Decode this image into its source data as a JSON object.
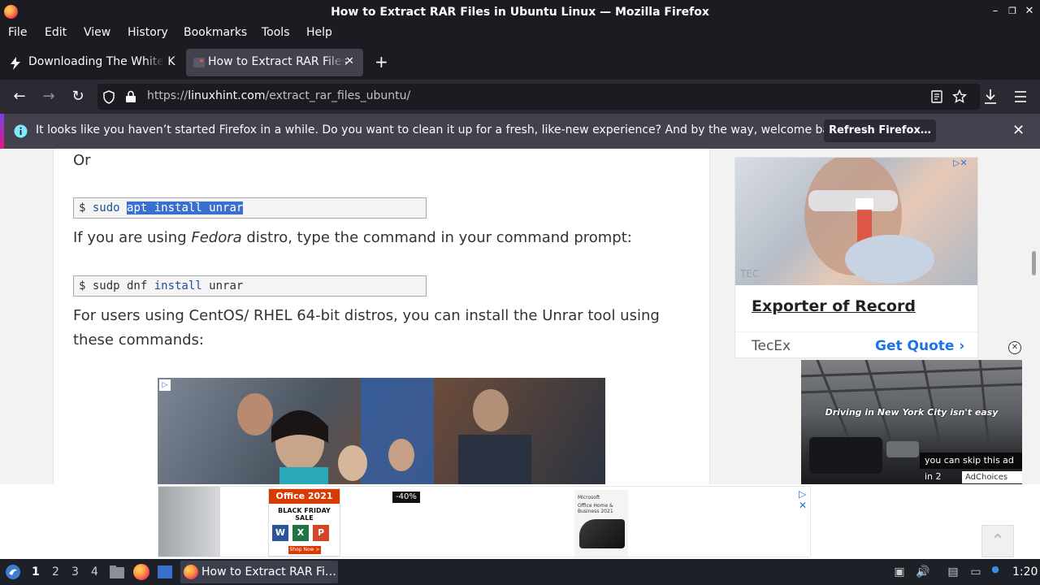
{
  "window": {
    "title": "How to Extract RAR Files in Ubuntu Linux — Mozilla Firefox",
    "controls": [
      "–",
      "❐",
      "✕"
    ]
  },
  "menu": [
    "File",
    "Edit",
    "View",
    "History",
    "Bookmarks",
    "Tools",
    "Help"
  ],
  "tabs": [
    {
      "label": "Downloading The White K",
      "active": false
    },
    {
      "label": "How to Extract RAR Files",
      "active": true
    }
  ],
  "new_tab": "+",
  "url": {
    "scheme": "https://",
    "host": "linuxhint.com",
    "path": "/extract_rar_files_ubuntu/"
  },
  "notification": {
    "message": "It looks like you haven’t started Firefox in a while. Do you want to clean it up for a fresh, like-new experience? And by the way, welcome back!",
    "button": "Refresh Firefox…"
  },
  "article": {
    "or": "Or",
    "cmd1": {
      "prompt": "$ ",
      "part1": "sudo ",
      "selected": "apt install unrar"
    },
    "fedora_pre": "If you are using ",
    "fedora_em": "Fedora",
    "fedora_post": " distro, type the command in your command prompt:",
    "cmd2": {
      "prompt": "$ ",
      "part1": "sudp dnf ",
      "kw": "install",
      "part2": " unrar"
    },
    "centos_line1": "For users using CentOS/ RHEL 64-bit distros, you can install the Unrar tool using",
    "centos_line2": "these commands:"
  },
  "side_ad": {
    "heading": "Exporter of Record",
    "brand": "TecEx",
    "cta": "Get Quote",
    "logo": "TEC"
  },
  "video_ad": {
    "caption": "Driving in New York City isn't easy",
    "skip": "you can skip this ad in 2",
    "adchoices": "AdChoices"
  },
  "bottom_ad": {
    "title": "Office 2021",
    "subtitle": "BLACK FRIDAY SALE",
    "discount": "-40%",
    "shop": "Shop Now >",
    "ms_brand": "Microsoft",
    "ms_product": "Office Home & Business 2021"
  },
  "taskbar": {
    "workspaces": [
      "1",
      "2",
      "3",
      "4"
    ],
    "task_label": "How to Extract RAR Fi…",
    "clock": "1:20"
  },
  "colors": {
    "accent": "#3a6fd0",
    "link": "#1a73e8",
    "chrome_dark": "#1c1b22",
    "toolbar": "#2b2a33"
  }
}
